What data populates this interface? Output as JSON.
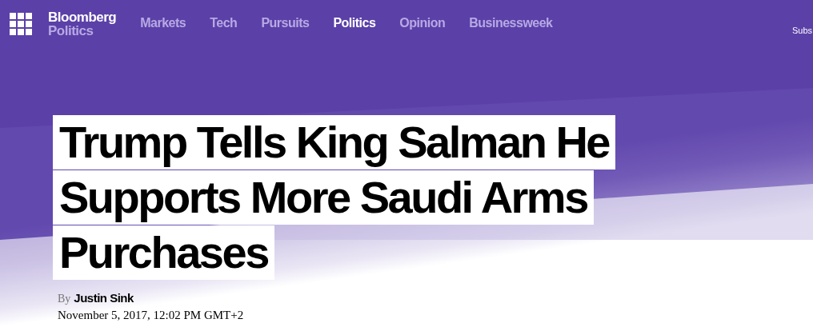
{
  "header": {
    "brand": "Bloomberg",
    "section": "Politics",
    "nav": [
      {
        "label": "Markets",
        "selected": false
      },
      {
        "label": "Tech",
        "selected": false
      },
      {
        "label": "Pursuits",
        "selected": false
      },
      {
        "label": "Politics",
        "selected": true
      },
      {
        "label": "Opinion",
        "selected": false
      },
      {
        "label": "Businessweek",
        "selected": false
      }
    ],
    "subscribe": "Subs"
  },
  "article": {
    "headline_lines": [
      "Trump Tells King Salman He",
      "Supports More Saudi Arms",
      "Purchases"
    ],
    "by": "By",
    "author": "Justin Sink",
    "date": "November 5, 2017, 12:02 PM GMT+2"
  }
}
